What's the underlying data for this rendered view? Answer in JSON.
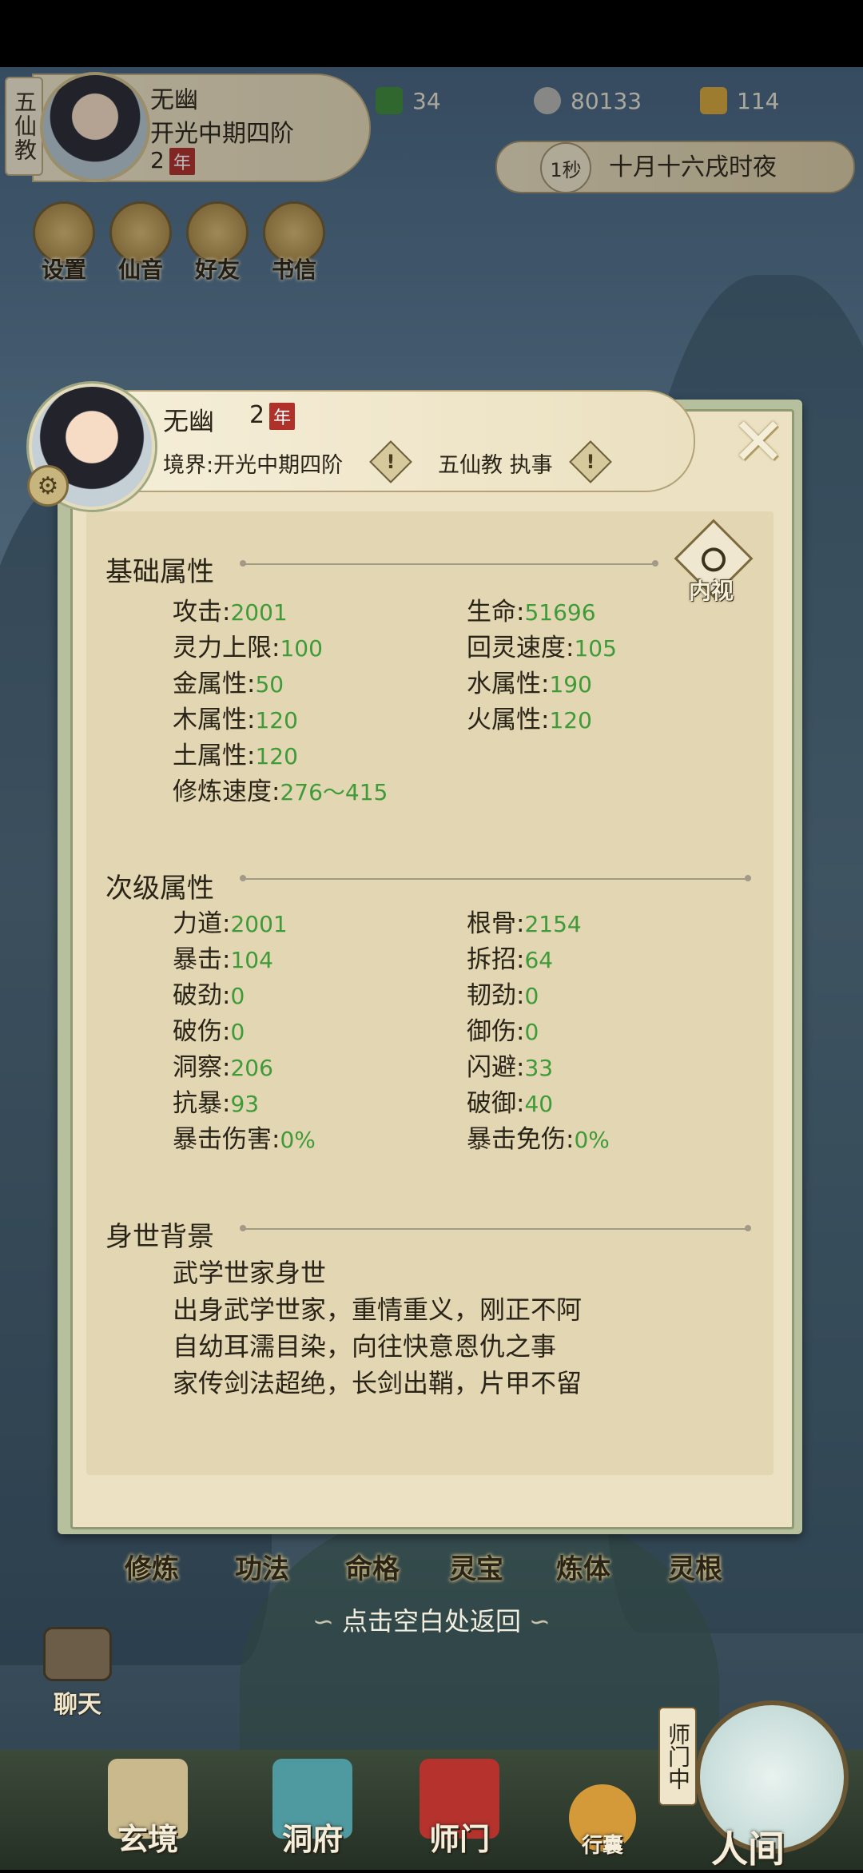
{
  "hud": {
    "sect": "五仙教",
    "name": "无幽",
    "realm": "开光中期四阶",
    "age_num": "2",
    "year_badge": "年",
    "jade": "34",
    "coins": "80133",
    "strength": "114",
    "time_speed": "1秒",
    "datetime": "十月十六戌时夜",
    "quick": [
      "设置",
      "仙音",
      "好友",
      "书信"
    ]
  },
  "profile": {
    "name": "无幽",
    "age_num": "2",
    "year_badge": "年",
    "realm": "境界:开光中期四阶",
    "sect_role": "五仙教 执事",
    "inner_view": "内视",
    "close_symbol": "✕",
    "basic": {
      "title": "基础属性",
      "left": [
        {
          "label": "攻击",
          "value": "2001"
        },
        {
          "label": "灵力上限",
          "value": "100"
        },
        {
          "label": "金属性",
          "value": "50"
        },
        {
          "label": "木属性",
          "value": "120"
        },
        {
          "label": "土属性",
          "value": "120"
        },
        {
          "label": "修炼速度",
          "value": "276～415"
        }
      ],
      "right": [
        {
          "label": "生命",
          "value": "51696"
        },
        {
          "label": "回灵速度",
          "value": "105"
        },
        {
          "label": "水属性",
          "value": "190"
        },
        {
          "label": "火属性",
          "value": "120"
        }
      ]
    },
    "secondary": {
      "title": "次级属性",
      "left": [
        {
          "label": "力道",
          "value": "2001"
        },
        {
          "label": "暴击",
          "value": "104"
        },
        {
          "label": "破劲",
          "value": "0"
        },
        {
          "label": "破伤",
          "value": "0"
        },
        {
          "label": "洞察",
          "value": "206"
        },
        {
          "label": "抗暴",
          "value": "93"
        },
        {
          "label": "暴击伤害",
          "value": "0%"
        }
      ],
      "right": [
        {
          "label": "根骨",
          "value": "2154"
        },
        {
          "label": "拆招",
          "value": "64"
        },
        {
          "label": "韧劲",
          "value": "0"
        },
        {
          "label": "御伤",
          "value": "0"
        },
        {
          "label": "闪避",
          "value": "33"
        },
        {
          "label": "破御",
          "value": "40"
        },
        {
          "label": "暴击免伤",
          "value": "0%"
        }
      ]
    },
    "background": {
      "title": "身世背景",
      "lines": [
        "武学世家身世",
        "出身武学世家，重情重义，刚正不阿",
        "自幼耳濡目染，向往快意恩仇之事",
        "家传剑法超绝，长剑出鞘，片甲不留"
      ]
    }
  },
  "cultivation_tabs": [
    "修炼",
    "功法",
    "命格",
    "灵宝",
    "炼体",
    "灵根"
  ],
  "return_hint": "点击空白处返回",
  "chat_label": "聊天",
  "bottom_nav": {
    "xuanjing": "玄境",
    "dongfu": "洞府",
    "shimen": "师门",
    "xingnang": "行囊",
    "renjian": "人间",
    "shimen_tag": "师门中"
  },
  "colors": {
    "stat_value": "#3f9a38",
    "panel_bg": "#e2d6b3",
    "frame": "#b7c09c",
    "year_badge": "#b0302a"
  }
}
